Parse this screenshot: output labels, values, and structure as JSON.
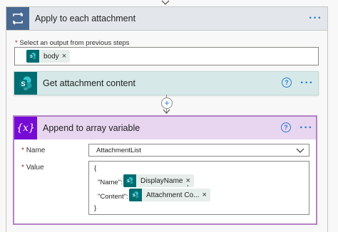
{
  "loop": {
    "title": "Apply to each attachment",
    "select_label": "Select an output from previous steps",
    "required_mark": "*",
    "token": {
      "label": "body",
      "remove": "×"
    }
  },
  "get_attachment": {
    "title": "Get attachment content",
    "help": "?"
  },
  "connector": {
    "add_symbol": "+"
  },
  "append_var": {
    "icon_text": "{x}",
    "title": "Append to array variable",
    "help": "?",
    "name_label": "Name",
    "name_value": "AttachmentList",
    "value_label": "Value",
    "required_mark": "*",
    "value_lines": {
      "open": "{",
      "name_key": "\"Name\":",
      "name_token": "DisplayName",
      "name_suffix": ",",
      "content_key": "\"Content\":",
      "content_token": "Attachment Co...",
      "close": "}"
    },
    "token_remove": "×"
  },
  "more_menu": "···",
  "colors": {
    "loop_accent": "#486991",
    "sharepoint": "#036c70",
    "variable_accent": "#770bd6",
    "link_blue": "#2b7ad1"
  },
  "icons": {
    "loop": "loop-icon",
    "sharepoint": "sharepoint-icon",
    "variable": "variable-icon",
    "help": "help-icon",
    "more": "more-options-icon",
    "chevron": "chevron-down-icon",
    "add": "add-step-icon"
  }
}
